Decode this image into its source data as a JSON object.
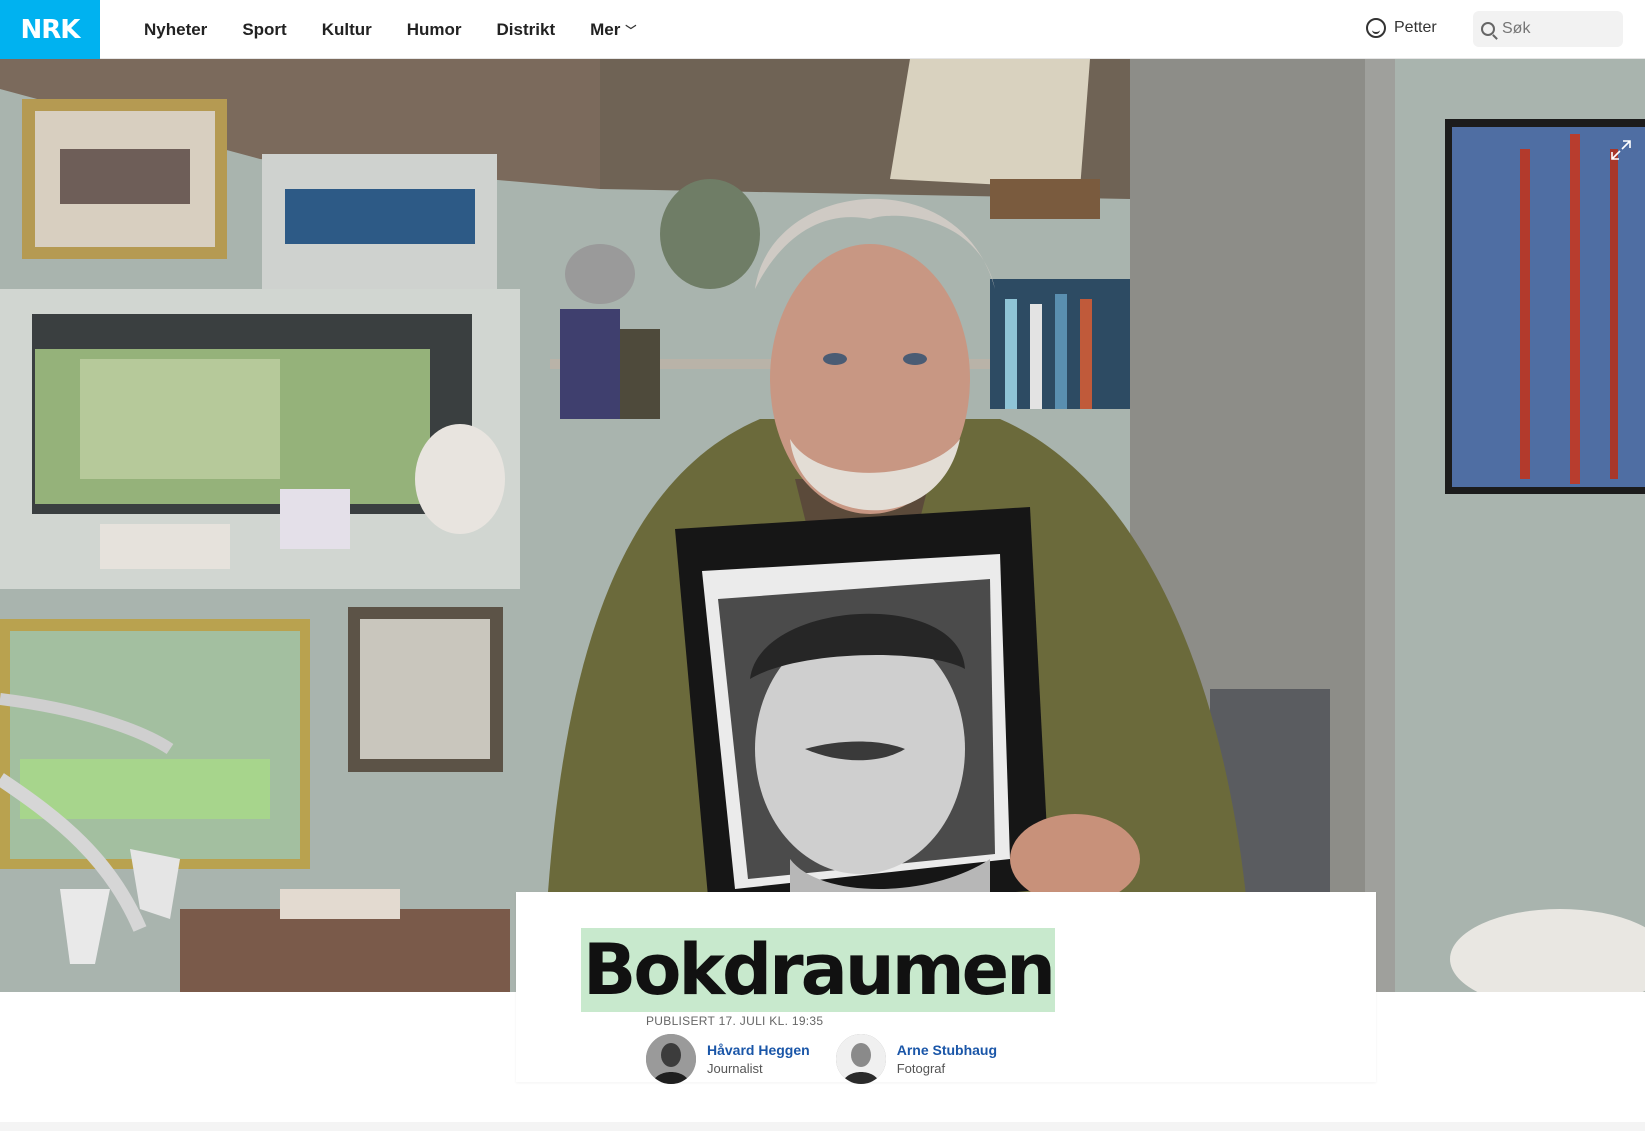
{
  "header": {
    "logo_text": "NRK",
    "nav": [
      {
        "label": "Nyheter"
      },
      {
        "label": "Sport"
      },
      {
        "label": "Kultur"
      },
      {
        "label": "Humor"
      },
      {
        "label": "Distrikt"
      },
      {
        "label": "Mer"
      }
    ],
    "user_name": "Petter",
    "search_placeholder": "Søk",
    "logo_color": "#00b2f0"
  },
  "hero": {
    "image_desc_icon": "expand-icon"
  },
  "article": {
    "title": "Bokdraumen",
    "published": "PUBLISERT 17. JULI KL. 19:35",
    "title_highlight": "#c8e9cd",
    "authors": [
      {
        "name": "Håvard Heggen",
        "role": "Journalist"
      },
      {
        "name": "Arne Stubhaug",
        "role": "Fotograf"
      }
    ]
  }
}
